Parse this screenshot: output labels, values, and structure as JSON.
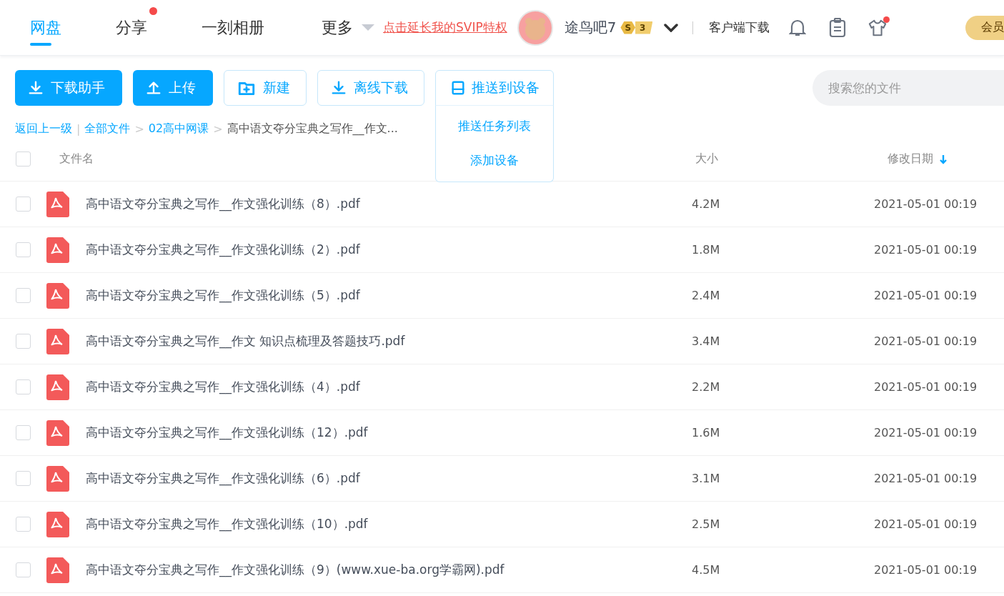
{
  "nav": {
    "tabs": [
      {
        "label": "网盘",
        "selected": true,
        "dot": false
      },
      {
        "label": "分享",
        "selected": false,
        "dot": true
      },
      {
        "label": "一刻相册",
        "selected": false,
        "dot": false
      }
    ],
    "more": "更多",
    "promo_link": "点击延长我的SVIP特权",
    "user": {
      "name": "途鸟吧7",
      "badge": "S",
      "level": "3"
    },
    "client_download": "客户端下载",
    "shirt_dot": true,
    "vip_button": "会员"
  },
  "toolbar": {
    "buttons": [
      {
        "label": "下载助手",
        "kind": "primary"
      },
      {
        "label": "上传",
        "kind": "primary"
      },
      {
        "label": "新建",
        "kind": "outline"
      },
      {
        "label": "离线下载",
        "kind": "outline"
      }
    ],
    "push": {
      "label": "推送到设备",
      "expanded": true,
      "items": [
        "推送任务列表",
        "添加设备"
      ]
    },
    "search": {
      "placeholder": "搜索您的文件"
    }
  },
  "breadcrumb": {
    "back": "返回上一级",
    "divider": "|",
    "arrow": ">",
    "items": [
      "全部文件",
      "02高中网课"
    ],
    "current": "高中语文夺分宝典之写作__作文..."
  },
  "table": {
    "all_checked": false,
    "columns": [
      {
        "label": "文件名",
        "sorted": false
      },
      {
        "label": "大小",
        "sorted": false
      },
      {
        "label": "修改日期",
        "sorted": true
      }
    ],
    "rows": [
      {
        "name": "高中语文夺分宝典之写作__作文强化训练（8）.pdf",
        "size": "4.2M",
        "date": "2021-05-01 00:19",
        "checked": false
      },
      {
        "name": "高中语文夺分宝典之写作__作文强化训练（2）.pdf",
        "size": "1.8M",
        "date": "2021-05-01 00:19",
        "checked": false
      },
      {
        "name": "高中语文夺分宝典之写作__作文强化训练（5）.pdf",
        "size": "2.4M",
        "date": "2021-05-01 00:19",
        "checked": false
      },
      {
        "name": "高中语文夺分宝典之写作__作文 知识点梳理及答题技巧.pdf",
        "size": "3.4M",
        "date": "2021-05-01 00:19",
        "checked": false
      },
      {
        "name": "高中语文夺分宝典之写作__作文强化训练（4）.pdf",
        "size": "2.2M",
        "date": "2021-05-01 00:19",
        "checked": false
      },
      {
        "name": "高中语文夺分宝典之写作__作文强化训练（12）.pdf",
        "size": "1.6M",
        "date": "2021-05-01 00:19",
        "checked": false
      },
      {
        "name": "高中语文夺分宝典之写作__作文强化训练（6）.pdf",
        "size": "3.1M",
        "date": "2021-05-01 00:19",
        "checked": false
      },
      {
        "name": "高中语文夺分宝典之写作__作文强化训练（10）.pdf",
        "size": "2.5M",
        "date": "2021-05-01 00:19",
        "checked": false
      },
      {
        "name": "高中语文夺分宝典之写作__作文强化训练（9）(www.xue-ba.org学霸网).pdf",
        "size": "4.5M",
        "date": "2021-05-01 00:19",
        "checked": false
      }
    ]
  }
}
